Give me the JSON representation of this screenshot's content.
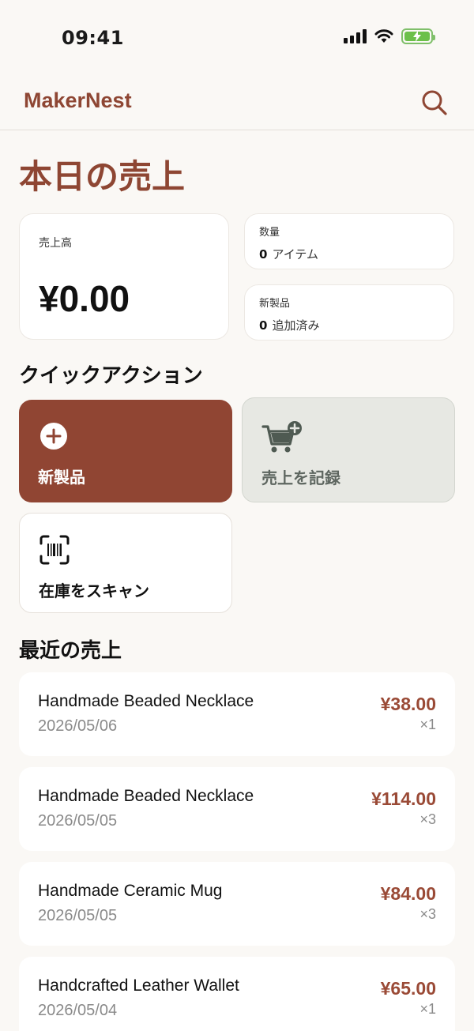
{
  "status_bar": {
    "time": "09:41"
  },
  "header": {
    "app_title": "MakerNest"
  },
  "page": {
    "title": "本日の売上"
  },
  "stats": {
    "sales_label": "売上高",
    "sales_value": "¥0.00",
    "quantity_label": "数量",
    "quantity_value": "0",
    "quantity_unit": "アイテム",
    "new_label": "新製品",
    "new_value": "0",
    "new_unit": "追加済み"
  },
  "quick_actions": {
    "title": "クイックアクション",
    "new_product": "新製品",
    "record_sale": "売上を記録",
    "scan_inventory": "在庫をスキャン"
  },
  "recent_sales": {
    "title": "最近の売上",
    "items": [
      {
        "name": "Handmade Beaded Necklace",
        "date": "2026/05/06",
        "price": "¥38.00",
        "qty": "×1"
      },
      {
        "name": "Handmade Beaded Necklace",
        "date": "2026/05/05",
        "price": "¥114.00",
        "qty": "×3"
      },
      {
        "name": "Handmade Ceramic Mug",
        "date": "2026/05/05",
        "price": "¥84.00",
        "qty": "×3"
      },
      {
        "name": "Handcrafted Leather Wallet",
        "date": "2026/05/04",
        "price": "¥65.00",
        "qty": "×1"
      }
    ]
  },
  "colors": {
    "brand": "#8e4633",
    "primary_button": "#904533",
    "price": "#9a4a36",
    "background": "#faf8f5"
  },
  "icons": {
    "search": "search-icon",
    "add": "plus-circle-icon",
    "cart": "cart-plus-icon",
    "scan": "barcode-scan-icon"
  }
}
